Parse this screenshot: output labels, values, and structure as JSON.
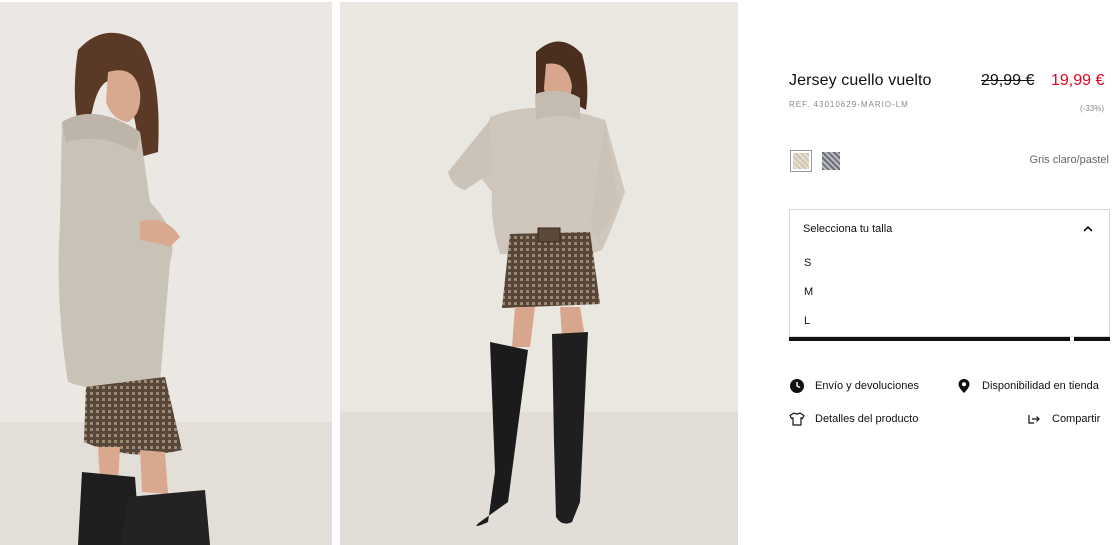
{
  "product": {
    "title": "Jersey cuello vuelto",
    "ref": "REF. 43010629-MARIO-LM",
    "price_old": "29,99 €",
    "price_new": "19,99 €",
    "discount": "(-33%)",
    "color_name": "Gris claro/pastel",
    "colors": {
      "accent": "#e3001b",
      "text": "#111111"
    }
  },
  "swatches": [
    {
      "name": "light-grey-pastel",
      "selected": true
    },
    {
      "name": "grey-pattern",
      "selected": false
    }
  ],
  "size_selector": {
    "label": "Selecciona tu talla",
    "expanded": true,
    "options": [
      "S",
      "M",
      "L"
    ]
  },
  "links": {
    "shipping": "Envío y devoluciones",
    "availability": "Disponibilidad en tienda",
    "details": "Detalles del producto",
    "share": "Compartir"
  },
  "icons": {
    "shipping": "clock-icon",
    "availability": "location-pin-icon",
    "details": "tshirt-icon",
    "share": "share-arrow-icon"
  }
}
